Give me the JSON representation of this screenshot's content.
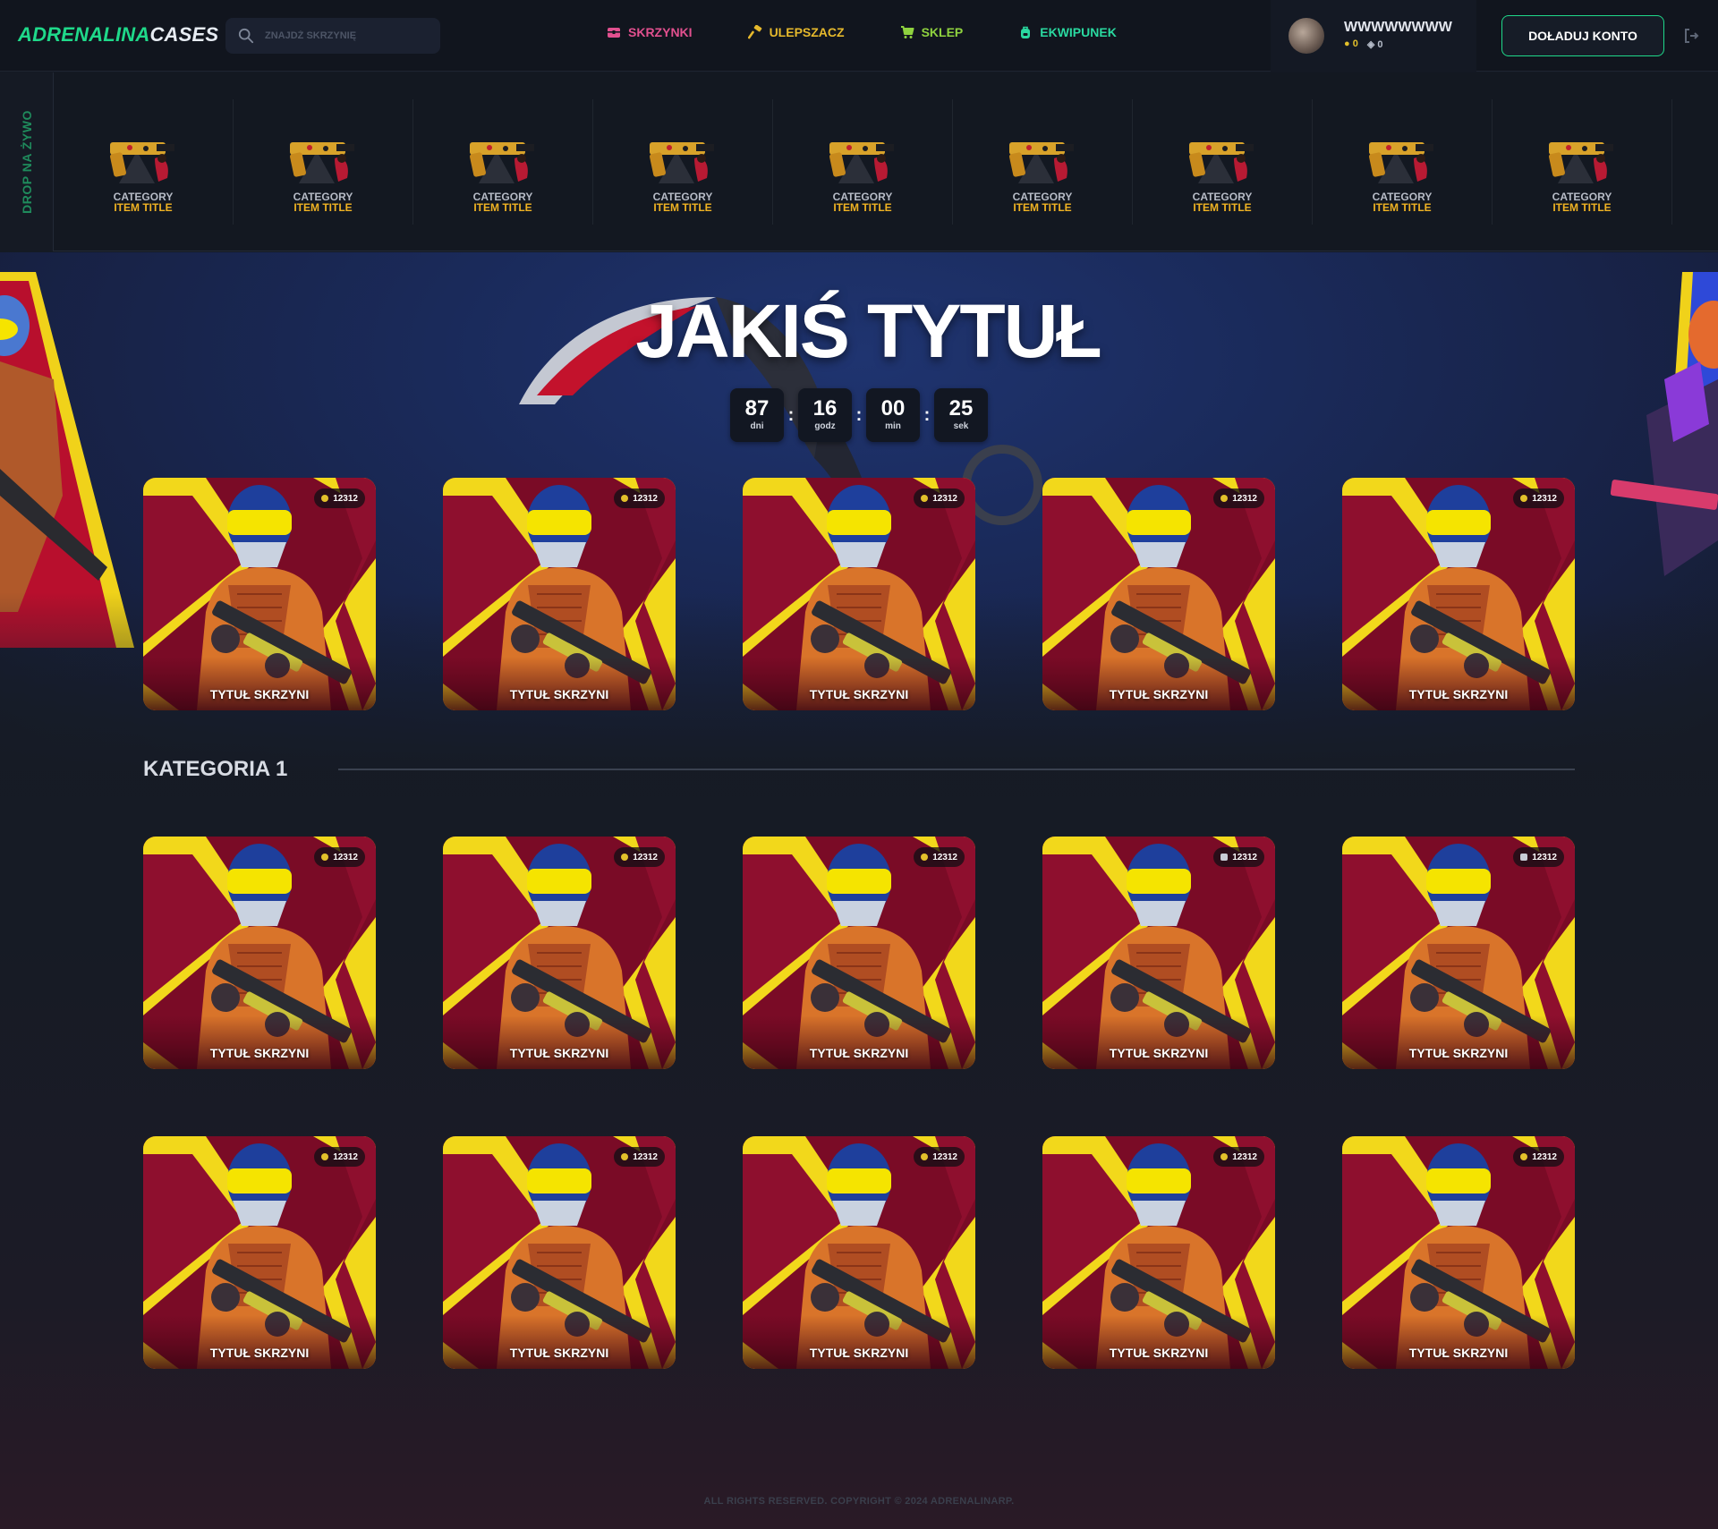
{
  "header": {
    "logo_part1": "ADRENALINA",
    "logo_part2": "CASES",
    "search_placeholder": "ZNAJDŹ SKRZYNIĘ",
    "nav": [
      {
        "label": "SKRZYNKI",
        "color": "#e2508f",
        "icon": "chest-icon"
      },
      {
        "label": "ULEPSZACZ",
        "color": "#e6b92c",
        "icon": "hammer-icon"
      },
      {
        "label": "SKLEP",
        "color": "#8fd23f",
        "icon": "cart-icon"
      },
      {
        "label": "EKWIPUNEK",
        "color": "#2ad9a0",
        "icon": "backpack-icon"
      }
    ],
    "user": {
      "name": "WWWWWWWW",
      "coins": "0",
      "gems": "0"
    },
    "topup_label": "DOŁADUJ KONTO"
  },
  "live_drop": {
    "label": "DROP NA ŻYWO",
    "items": [
      {
        "category": "CATEGORY",
        "title": "ITEM TITLE"
      },
      {
        "category": "CATEGORY",
        "title": "ITEM TITLE"
      },
      {
        "category": "CATEGORY",
        "title": "ITEM TITLE"
      },
      {
        "category": "CATEGORY",
        "title": "ITEM TITLE"
      },
      {
        "category": "CATEGORY",
        "title": "ITEM TITLE"
      },
      {
        "category": "CATEGORY",
        "title": "ITEM TITLE"
      },
      {
        "category": "CATEGORY",
        "title": "ITEM TITLE"
      },
      {
        "category": "CATEGORY",
        "title": "ITEM TITLE"
      },
      {
        "category": "CATEGORY",
        "title": "ITEM TITLE"
      }
    ]
  },
  "hero": {
    "title": "JAKIŚ TYTUŁ",
    "timer": [
      {
        "value": "87",
        "unit": "dni"
      },
      {
        "value": "16",
        "unit": "godz"
      },
      {
        "value": "00",
        "unit": "min"
      },
      {
        "value": "25",
        "unit": "sek"
      }
    ],
    "cases": [
      {
        "title": "TYTUŁ SKRZYNI",
        "price": "12312",
        "currency": "coin"
      },
      {
        "title": "TYTUŁ SKRZYNI",
        "price": "12312",
        "currency": "coin"
      },
      {
        "title": "TYTUŁ SKRZYNI",
        "price": "12312",
        "currency": "coin"
      },
      {
        "title": "TYTUŁ SKRZYNI",
        "price": "12312",
        "currency": "coin"
      },
      {
        "title": "TYTUŁ SKRZYNI",
        "price": "12312",
        "currency": "coin"
      }
    ]
  },
  "category1": {
    "title": "KATEGORIA 1",
    "row1": [
      {
        "title": "TYTUŁ SKRZYNI",
        "price": "12312",
        "currency": "coin"
      },
      {
        "title": "TYTUŁ SKRZYNI",
        "price": "12312",
        "currency": "coin"
      },
      {
        "title": "TYTUŁ SKRZYNI",
        "price": "12312",
        "currency": "coin"
      },
      {
        "title": "TYTUŁ SKRZYNI",
        "price": "12312",
        "currency": "gem"
      },
      {
        "title": "TYTUŁ SKRZYNI",
        "price": "12312",
        "currency": "gem"
      }
    ],
    "row2": [
      {
        "title": "TYTUŁ SKRZYNI",
        "price": "12312",
        "currency": "coin"
      },
      {
        "title": "TYTUŁ SKRZYNI",
        "price": "12312",
        "currency": "coin"
      },
      {
        "title": "TYTUŁ SKRZYNI",
        "price": "12312",
        "currency": "coin"
      },
      {
        "title": "TYTUŁ SKRZYNI",
        "price": "12312",
        "currency": "coin"
      },
      {
        "title": "TYTUŁ SKRZYNI",
        "price": "12312",
        "currency": "coin"
      }
    ]
  },
  "footer": {
    "text": "ALL RIGHTS RESERVED. COPYRIGHT © 2024 ADRENALINARP."
  },
  "colors": {
    "accent": "#1fd98a",
    "item_title": "#f0b323",
    "card_red": "#7a0b26",
    "card_yellow": "#f2d81b"
  }
}
